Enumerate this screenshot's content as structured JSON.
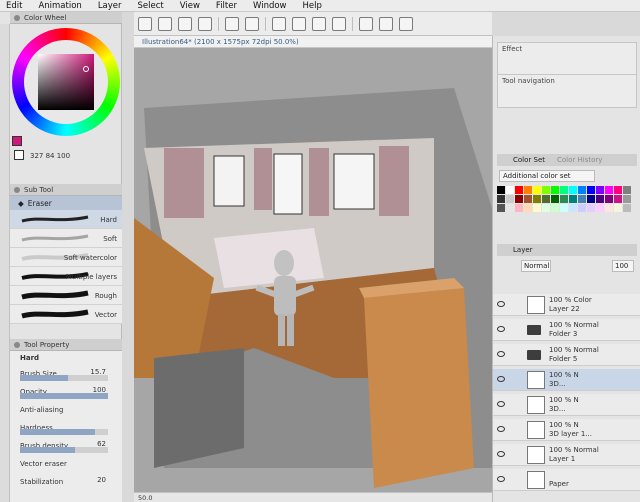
{
  "menu": [
    "Edit",
    "Animation",
    "Layer",
    "Select",
    "View",
    "Filter",
    "Window",
    "Help"
  ],
  "left": {
    "color_wheel_tab": "Color Wheel",
    "hsv_text": "327 84 100",
    "sub_tool_tab": "Sub Tool",
    "eraser_label": "Eraser",
    "brushes": [
      {
        "label": "Hard"
      },
      {
        "label": "Soft"
      },
      {
        "label": "Soft watercolor"
      },
      {
        "label": "Multiple layers"
      },
      {
        "label": "Rough"
      },
      {
        "label": "Vector"
      }
    ],
    "tool_property_tab": "Tool Property",
    "tool_prop_head": "Hard",
    "props": [
      {
        "label": "Brush Size",
        "value": "15.7",
        "level": 0.55
      },
      {
        "label": "Opacity",
        "value": "100",
        "level": 1.0
      },
      {
        "label": "Anti-aliasing",
        "value": "",
        "level": 0.0
      },
      {
        "label": "Hardness",
        "value": "",
        "level": 0.85
      },
      {
        "label": "Brush density",
        "value": "62",
        "level": 0.62
      },
      {
        "label": "Vector eraser",
        "value": "",
        "level": 0.0
      },
      {
        "label": "Stabilization",
        "value": "20",
        "level": 0.2
      }
    ]
  },
  "doc_tab": "Illustration64* (2100 x 1575px 72dpi 50.0%)",
  "status": "50.0",
  "right": {
    "effect_title": "Effect",
    "tool_nav_title": "Tool navigation",
    "color_set_tab": "Color Set",
    "color_history_tab": "Color History",
    "color_set_select": "Additional color set",
    "layer_tab": "Layer",
    "blend_mode": "Normal",
    "opacity": "100",
    "layers": [
      {
        "pct": "100 % Color",
        "name": "Layer 22",
        "type": "layer",
        "selected": false
      },
      {
        "pct": "100 % Normal",
        "name": "Folder 3",
        "type": "folder",
        "selected": false
      },
      {
        "pct": "100 % Normal",
        "name": "Folder 5",
        "type": "folder",
        "selected": false
      },
      {
        "pct": "100 % N",
        "name": "3D...",
        "type": "layer",
        "selected": true
      },
      {
        "pct": "100 % N",
        "name": "3D...",
        "type": "layer",
        "selected": false
      },
      {
        "pct": "100 % N",
        "name": "3D layer 1...",
        "type": "layer",
        "selected": false
      },
      {
        "pct": "100 % Normal",
        "name": "Layer 1",
        "type": "layer",
        "selected": false
      },
      {
        "pct": "",
        "name": "Paper",
        "type": "paper",
        "selected": false
      }
    ]
  },
  "colors": {
    "accent": "#d0187b",
    "selection": "#c9d6e8",
    "panel": "#ececec"
  }
}
